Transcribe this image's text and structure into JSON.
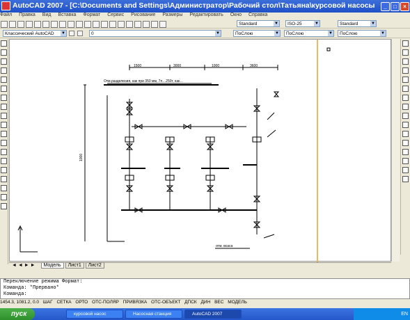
{
  "window": {
    "title": "AutoCAD 2007 - [C:\\Documents and Settings\\Администратор\\Рабочий стол\\Татьяна\\курсовой насосы\\насосная с...",
    "min": "_",
    "max": "□",
    "close": "×"
  },
  "menu": [
    "Файл",
    "Правка",
    "Вид",
    "Вставка",
    "Формат",
    "Сервис",
    "Рисование",
    "Размеры",
    "Редактировать",
    "Окно",
    "Справка"
  ],
  "toolbar": {
    "textstyle": "Standard",
    "dimstyle": "ISO-25",
    "tablestyle": "Standard",
    "workspace": "Классический AutoCAD",
    "layer": "0",
    "color": "ПоСлою",
    "linetype": "ПоСлою",
    "lineweight": "ПоСлою"
  },
  "tabs": [
    "Модель",
    "Лист1",
    "Лист2"
  ],
  "command": {
    "line1": "Переключение режима Формат:",
    "line2": "Команда: *Прервано*",
    "line3": "Команда:"
  },
  "status": {
    "coords": "1454.3, 1081.2, 0.0",
    "toggles": [
      "ШАГ",
      "СЕТКА",
      "ОРТО",
      "ОТС-ПОЛЯР",
      "ПРИВЯЗКА",
      "ОТС-ОБЪЕКТ",
      "ДПСК",
      "ДИН",
      "ВЕС",
      "МОДЕЛЬ"
    ]
  },
  "taskbar": {
    "start": "пуск",
    "items": [
      "курсовой насос",
      "Насосная станция",
      "AutoCAD 2007"
    ],
    "tray": "EN"
  },
  "drawing": {
    "header_note": "Отм.разделения, как при 350 мм, 7п…250т, как…",
    "dims": [
      "1500",
      "3000",
      "1000",
      "3600"
    ],
    "side_dim": "1000",
    "bottom_note": "отм. всаса"
  }
}
